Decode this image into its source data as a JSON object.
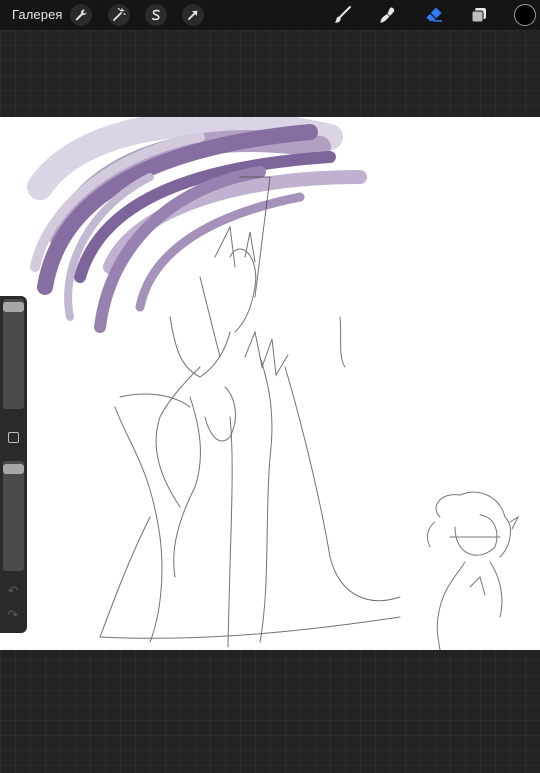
{
  "app": {
    "gallery_label": "Галерея"
  },
  "toolbar_left": [
    {
      "name": "actions-wrench-icon"
    },
    {
      "name": "adjustments-wand-icon"
    },
    {
      "name": "selection-s-icon"
    },
    {
      "name": "transform-arrow-icon"
    }
  ],
  "toolbar_right": [
    {
      "name": "brush-icon",
      "active": false
    },
    {
      "name": "smudge-icon",
      "active": false
    },
    {
      "name": "eraser-icon",
      "active": true
    },
    {
      "name": "layers-icon",
      "active": false
    }
  ],
  "colors": {
    "active_tool": "#2f7bf5",
    "current_color": "#000000",
    "hair_purple": "#7a5f98"
  },
  "sidebar": {
    "brush_size_level": 0.97,
    "opacity_level": 0.97
  }
}
